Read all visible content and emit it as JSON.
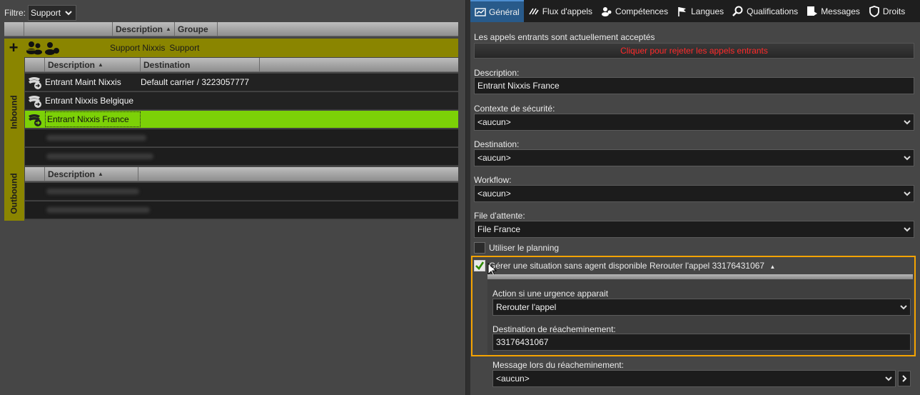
{
  "filter": {
    "label": "Filtre:",
    "value": "Support"
  },
  "top_grid": {
    "columns": [
      "",
      "",
      "Description",
      "Groupe"
    ]
  },
  "group": {
    "name": "Support Nixxis",
    "group": "Support"
  },
  "inbound": {
    "side_label": "Inbound",
    "columns": [
      "",
      "Description",
      "Destination"
    ],
    "rows": [
      {
        "description": "Entrant Maint Nixxis",
        "destination": "Default carrier / 3223057777"
      },
      {
        "description": "Entrant Nixxis Belgique",
        "destination": ""
      },
      {
        "description": "Entrant Nixxis France",
        "destination": ""
      }
    ]
  },
  "outbound": {
    "side_label": "Outbound",
    "columns": [
      "",
      "Description",
      ""
    ]
  },
  "tabs": [
    {
      "label": "Général",
      "icon": "chart-icon"
    },
    {
      "label": "Flux d'appels",
      "icon": "flow-icon"
    },
    {
      "label": "Compétences",
      "icon": "skills-icon"
    },
    {
      "label": "Langues",
      "icon": "flag-icon"
    },
    {
      "label": "Qualifications",
      "icon": "search-icon"
    },
    {
      "label": "Messages",
      "icon": "message-icon"
    },
    {
      "label": "Droits",
      "icon": "shield-icon"
    }
  ],
  "general": {
    "status_text": "Les appels entrants sont actuellement acceptés",
    "reject_button": "Cliquer pour rejeter les appels entrants",
    "description_label": "Description:",
    "description_value": "Entrant Nixxis France",
    "security_label": "Contexte de sécurité:",
    "security_value": "<aucun>",
    "destination_label": "Destination:",
    "destination_value": "<aucun>",
    "workflow_label": "Workflow:",
    "workflow_value": "<aucun>",
    "queue_label": "File d'attente:",
    "queue_value": "File France",
    "planning_label": "Utiliser le planning",
    "urgency_label": "Gérer une situation sans agent disponible",
    "urgency_summary": "Rerouter l'appel 33176431067",
    "action_label": "Action si une urgence apparait",
    "action_value": "Rerouter l'appel",
    "reroute_dest_label": "Destination de réacheminement:",
    "reroute_dest_value": "33176431067",
    "reroute_msg_label": "Message lors du réacheminement:",
    "reroute_msg_value": "<aucun>"
  },
  "colors": {
    "accent_tab": "#285a8a",
    "selected_row": "#7cd107",
    "group_olive": "#8a8500",
    "highlight_border": "#f5a300",
    "reject_text": "#ff2a2a"
  }
}
